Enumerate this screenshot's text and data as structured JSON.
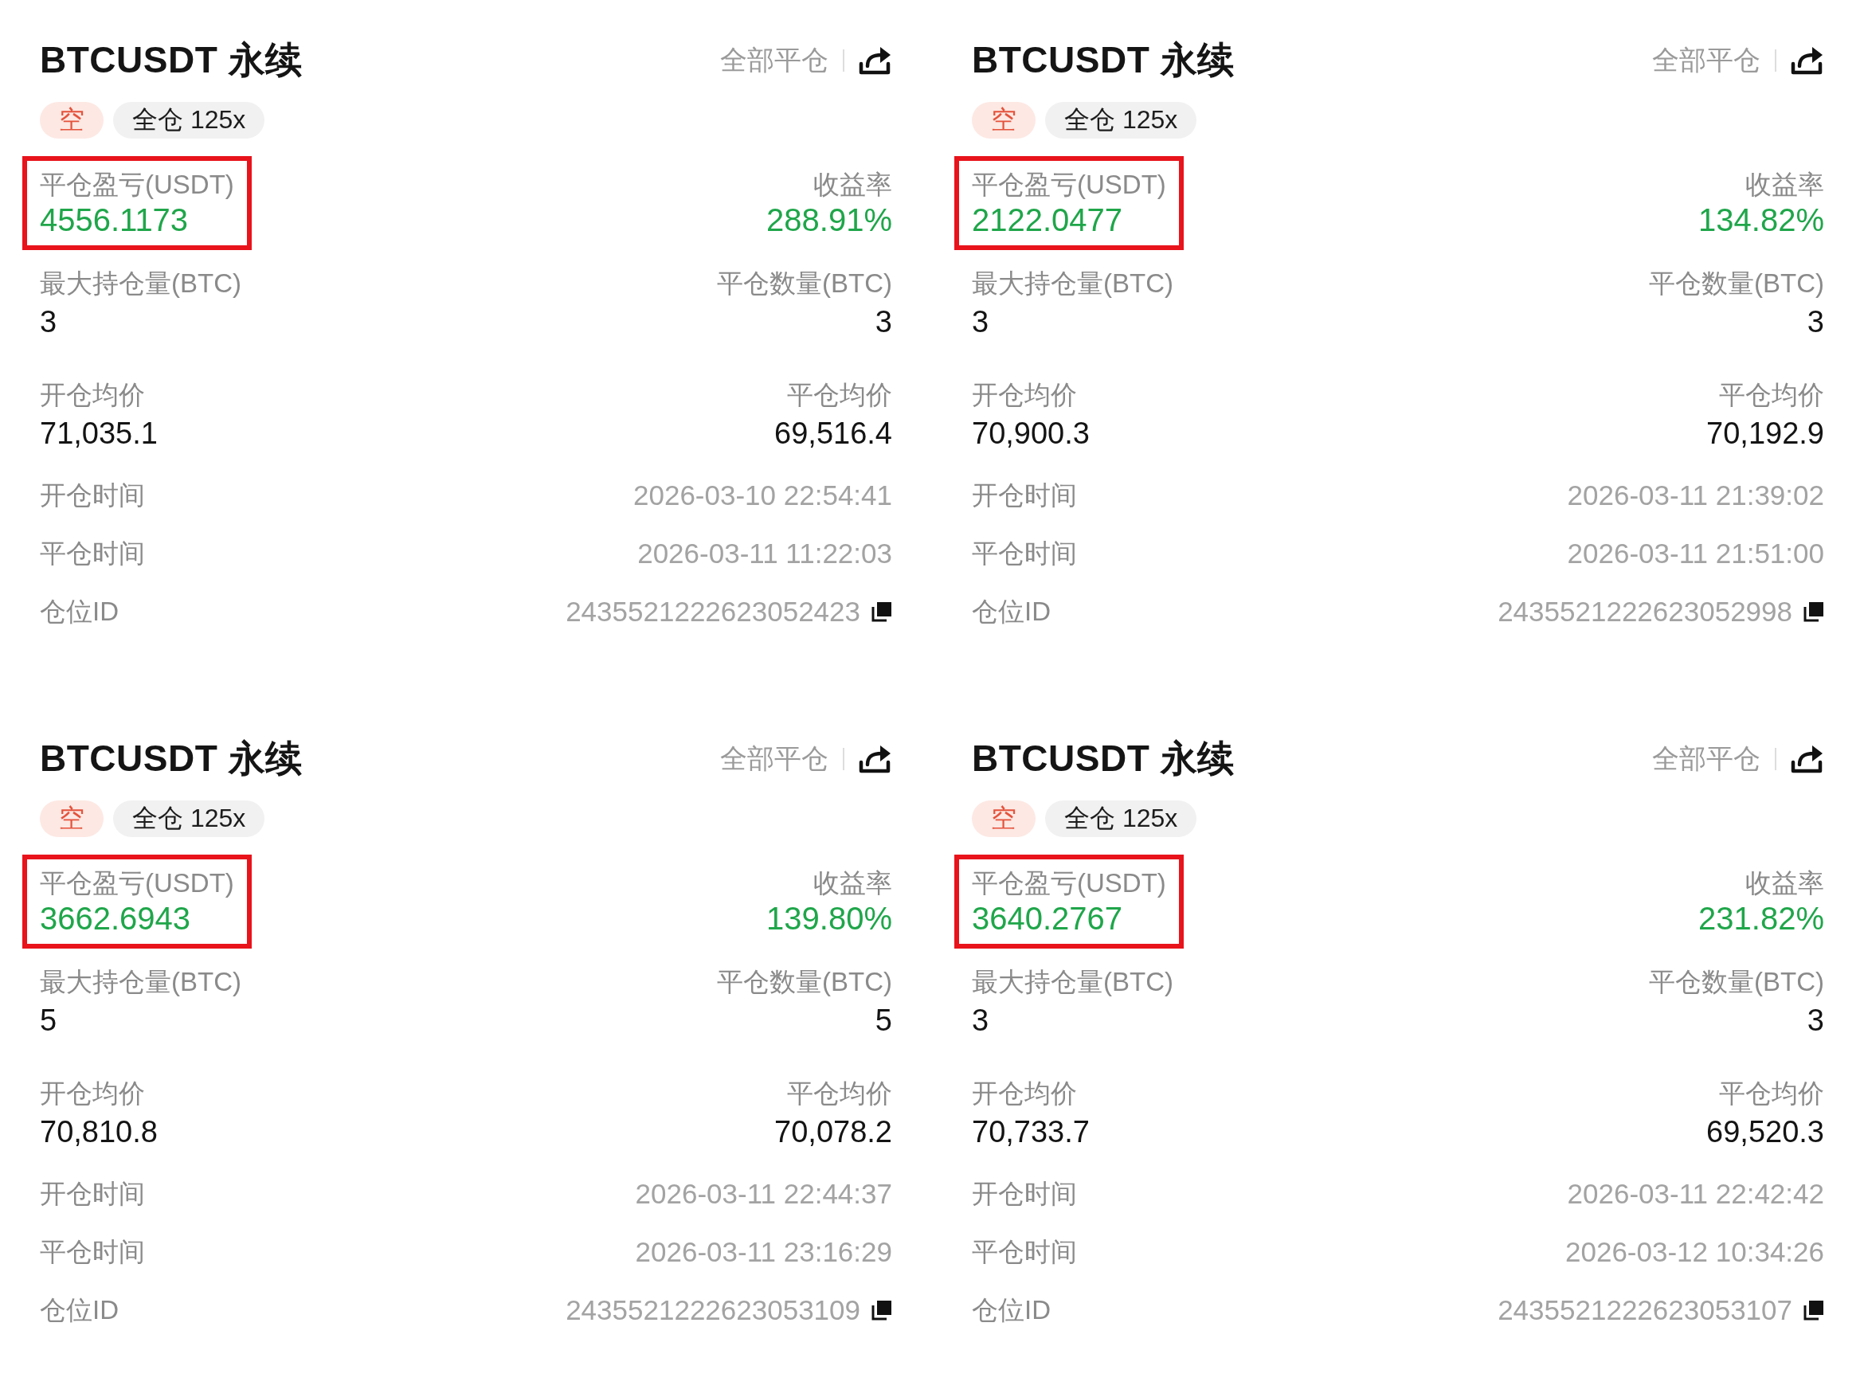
{
  "cards": [
    {
      "title": "BTCUSDT 永续",
      "close_all": "全部平仓",
      "tags": [
        {
          "kind": "side",
          "label": "空"
        },
        {
          "kind": "margin",
          "label": "全仓 125x"
        }
      ],
      "pnl": {
        "label": "平仓盈亏(USDT)",
        "value": "4556.1173",
        "highlighted": true
      },
      "roi": {
        "label": "收益率",
        "value": "288.91%"
      },
      "stats": [
        {
          "label": "最大持仓量(BTC)",
          "value": "3"
        },
        {
          "label": "平仓数量(BTC)",
          "value": "3"
        },
        {
          "label": "开仓均价",
          "value": "71,035.1"
        },
        {
          "label": "平仓均价",
          "value": "69,516.4"
        }
      ],
      "details": [
        {
          "kind": "time",
          "label": "开仓时间",
          "value": "2026-03-10 22:54:41"
        },
        {
          "kind": "time",
          "label": "平仓时间",
          "value": "2026-03-11 11:22:03"
        },
        {
          "kind": "id",
          "label": "仓位ID",
          "value": "2435521222623052423"
        }
      ]
    },
    {
      "title": "BTCUSDT 永续",
      "close_all": "全部平仓",
      "tags": [
        {
          "kind": "side",
          "label": "空"
        },
        {
          "kind": "margin",
          "label": "全仓 125x"
        }
      ],
      "pnl": {
        "label": "平仓盈亏(USDT)",
        "value": "2122.0477",
        "highlighted": true
      },
      "roi": {
        "label": "收益率",
        "value": "134.82%"
      },
      "stats": [
        {
          "label": "最大持仓量(BTC)",
          "value": "3"
        },
        {
          "label": "平仓数量(BTC)",
          "value": "3"
        },
        {
          "label": "开仓均价",
          "value": "70,900.3"
        },
        {
          "label": "平仓均价",
          "value": "70,192.9"
        }
      ],
      "details": [
        {
          "kind": "time",
          "label": "开仓时间",
          "value": "2026-03-11 21:39:02"
        },
        {
          "kind": "time",
          "label": "平仓时间",
          "value": "2026-03-11 21:51:00"
        },
        {
          "kind": "id",
          "label": "仓位ID",
          "value": "2435521222623052998"
        }
      ]
    },
    {
      "title": "BTCUSDT 永续",
      "close_all": "全部平仓",
      "tags": [
        {
          "kind": "side",
          "label": "空"
        },
        {
          "kind": "margin",
          "label": "全仓 125x"
        }
      ],
      "pnl": {
        "label": "平仓盈亏(USDT)",
        "value": "3662.6943",
        "highlighted": true
      },
      "roi": {
        "label": "收益率",
        "value": "139.80%"
      },
      "stats": [
        {
          "label": "最大持仓量(BTC)",
          "value": "5"
        },
        {
          "label": "平仓数量(BTC)",
          "value": "5"
        },
        {
          "label": "开仓均价",
          "value": "70,810.8"
        },
        {
          "label": "平仓均价",
          "value": "70,078.2"
        }
      ],
      "details": [
        {
          "kind": "time",
          "label": "开仓时间",
          "value": "2026-03-11 22:44:37"
        },
        {
          "kind": "time",
          "label": "平仓时间",
          "value": "2026-03-11 23:16:29"
        },
        {
          "kind": "id",
          "label": "仓位ID",
          "value": "2435521222623053109"
        }
      ]
    },
    {
      "title": "BTCUSDT 永续",
      "close_all": "全部平仓",
      "tags": [
        {
          "kind": "side",
          "label": "空"
        },
        {
          "kind": "margin",
          "label": "全仓 125x"
        }
      ],
      "pnl": {
        "label": "平仓盈亏(USDT)",
        "value": "3640.2767",
        "highlighted": true
      },
      "roi": {
        "label": "收益率",
        "value": "231.82%"
      },
      "stats": [
        {
          "label": "最大持仓量(BTC)",
          "value": "3"
        },
        {
          "label": "平仓数量(BTC)",
          "value": "3"
        },
        {
          "label": "开仓均价",
          "value": "70,733.7"
        },
        {
          "label": "平仓均价",
          "value": "69,520.3"
        }
      ],
      "details": [
        {
          "kind": "time",
          "label": "开仓时间",
          "value": "2026-03-11 22:42:42"
        },
        {
          "kind": "time",
          "label": "平仓时间",
          "value": "2026-03-12 10:34:26"
        },
        {
          "kind": "id",
          "label": "仓位ID",
          "value": "2435521222623053107"
        }
      ]
    }
  ]
}
